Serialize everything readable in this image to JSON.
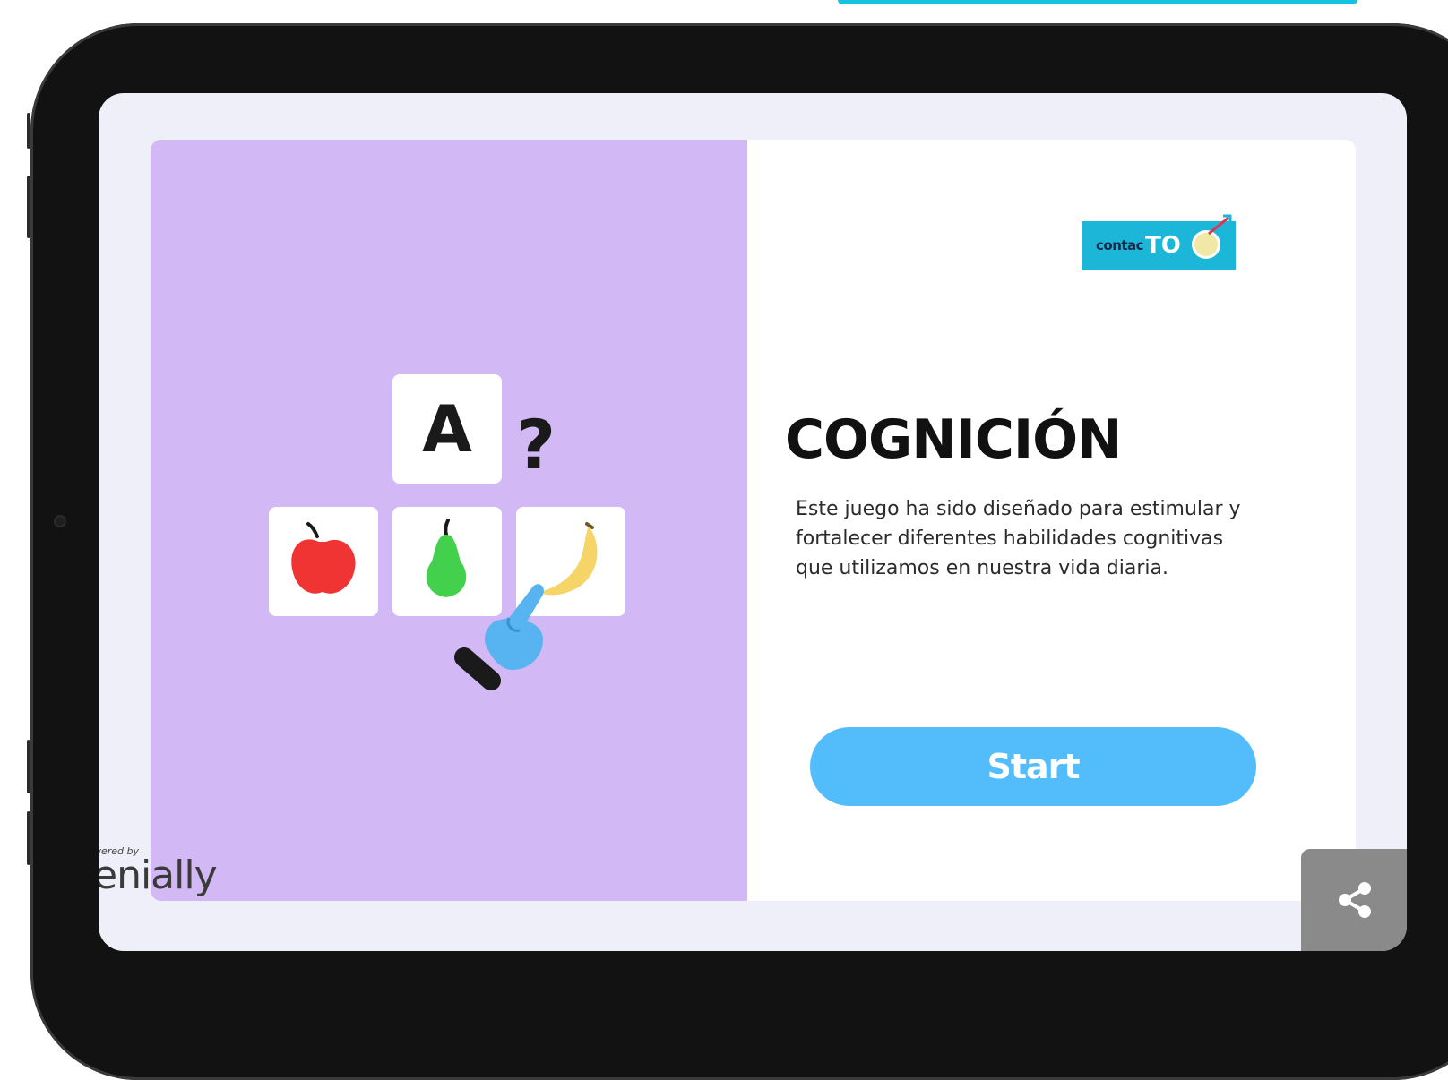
{
  "game": {
    "title": "COGNICIÓN",
    "description": "Este juego ha sido diseñado para estimular y fortalecer diferentes habilidades cognitivas que utilizamos en nuestra vida diaria.",
    "start_label": "Start"
  },
  "illustration": {
    "letter_tile": "A",
    "question_mark": "?",
    "tiles": [
      "apple-icon",
      "pear-icon",
      "banana-icon"
    ],
    "pointer": "pointing-hand-icon"
  },
  "logo": {
    "text": "contac",
    "suffix": "TO"
  },
  "footer": {
    "powered_by": "wered by",
    "brand": "enially",
    "share_icon": "share-icon"
  },
  "colors": {
    "left_panel": "#d2b8f4",
    "start_button": "#53bdfb",
    "logo_bg": "#1cb6d8",
    "share_button": "#8a8a8a",
    "apple": "#f03434",
    "pear": "#43d04c",
    "banana": "#f5d567",
    "hand": "#58b4f0"
  }
}
